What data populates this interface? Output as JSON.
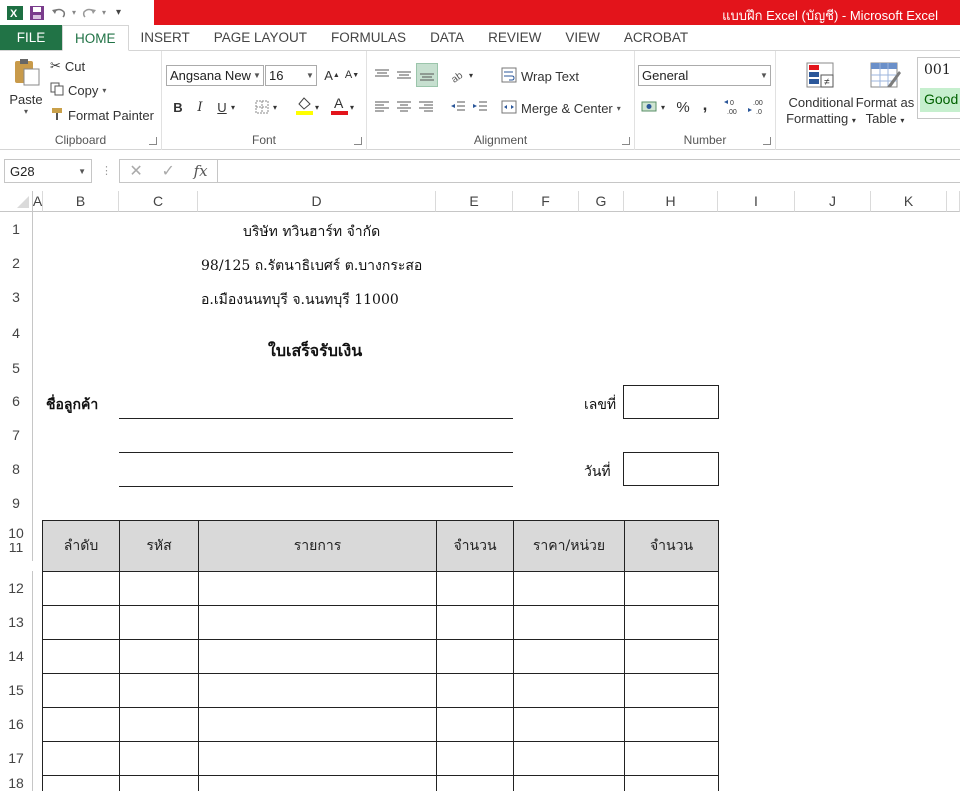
{
  "window": {
    "title": "แบบฝึก Excel (บัญชี) -  Microsoft Excel"
  },
  "tabs": [
    "FILE",
    "HOME",
    "INSERT",
    "PAGE LAYOUT",
    "FORMULAS",
    "DATA",
    "REVIEW",
    "VIEW",
    "ACROBAT"
  ],
  "ribbon": {
    "clipboard": {
      "paste": "Paste",
      "cut": "Cut",
      "copy": "Copy",
      "format_painter": "Format Painter",
      "label": "Clipboard"
    },
    "font": {
      "name": "Angsana New",
      "size": "16",
      "label": "Font"
    },
    "alignment": {
      "wrap_text": "Wrap Text",
      "merge_center": "Merge & Center",
      "label": "Alignment"
    },
    "number": {
      "format": "General",
      "percent": "%",
      "comma": ",",
      "label": "Number"
    },
    "styles": {
      "conditional": "Conditional",
      "formatting": "Formatting",
      "format_as": "Format as",
      "table": "Table",
      "style_value": "001",
      "good": "Good"
    }
  },
  "formula_bar": {
    "name_box": "G28",
    "fx": "fx",
    "content": ""
  },
  "columns": [
    "A",
    "B",
    "C",
    "D",
    "E",
    "F",
    "G",
    "H",
    "I",
    "J",
    "K"
  ],
  "rows": [
    "1",
    "2",
    "3",
    "4",
    "5",
    "6",
    "7",
    "8",
    "9",
    "10",
    "11",
    "12",
    "13",
    "14",
    "15",
    "16",
    "17",
    "18"
  ],
  "sheet": {
    "company": "บริษัท ทวินฮาร์ท จำกัด",
    "address1": "98/125 ถ.รัตนาธิเบศร์ ต.บางกระสอ",
    "address2": "อ.เมืองนนทบุรี จ.นนทบุรี 11000",
    "doc_title": "ใบเสร็จรับเงิน",
    "customer_label": "ชื่อลูกค้า",
    "number_label": "เลขที่",
    "date_label": "วันที่",
    "table_headers": [
      "ลำดับ",
      "รหัส",
      "รายการ",
      "จำนวน",
      "ราคา/หน่วย",
      "จำนวน"
    ]
  },
  "colors": {
    "excel_green": "#217346",
    "title_red": "#e3141b",
    "header_fill": "#d9d9d9",
    "good_fill": "#c6efce",
    "good_text": "#006100"
  }
}
